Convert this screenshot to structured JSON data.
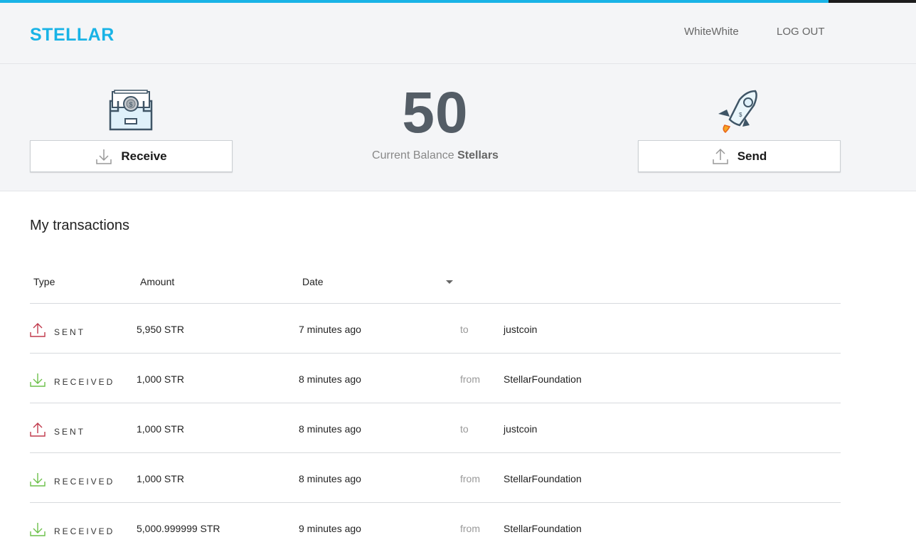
{
  "header": {
    "logo": "STELLAR",
    "username": "WhiteWhite",
    "logout": "LOG OUT"
  },
  "balance": {
    "amount": "50",
    "caption_prefix": "Current Balance",
    "caption_unit": "Stellars"
  },
  "actions": {
    "receive_label": "Receive",
    "send_label": "Send"
  },
  "transactions": {
    "title": "My transactions",
    "columns": {
      "type": "Type",
      "amount": "Amount",
      "date": "Date"
    },
    "rows": [
      {
        "type": "SENT",
        "amount": "5,950 STR",
        "date": "7 minutes ago",
        "direction": "to",
        "party": "justcoin"
      },
      {
        "type": "RECEIVED",
        "amount": "1,000 STR",
        "date": "8 minutes ago",
        "direction": "from",
        "party": "StellarFoundation"
      },
      {
        "type": "SENT",
        "amount": "1,000 STR",
        "date": "8 minutes ago",
        "direction": "to",
        "party": "justcoin"
      },
      {
        "type": "RECEIVED",
        "amount": "1,000 STR",
        "date": "8 minutes ago",
        "direction": "from",
        "party": "StellarFoundation"
      },
      {
        "type": "RECEIVED",
        "amount": "5,000.999999 STR",
        "date": "9 minutes ago",
        "direction": "from",
        "party": "StellarFoundation"
      }
    ]
  },
  "colors": {
    "brand": "#19b3e6",
    "sent": "#c0394b",
    "received": "#6cc04a",
    "balance": "#545d66"
  },
  "icons": {
    "receive_hero": "cash-drawer-icon",
    "send_hero": "rocket-icon",
    "receive_button": "download-arrow-icon",
    "send_button": "upload-arrow-icon"
  }
}
